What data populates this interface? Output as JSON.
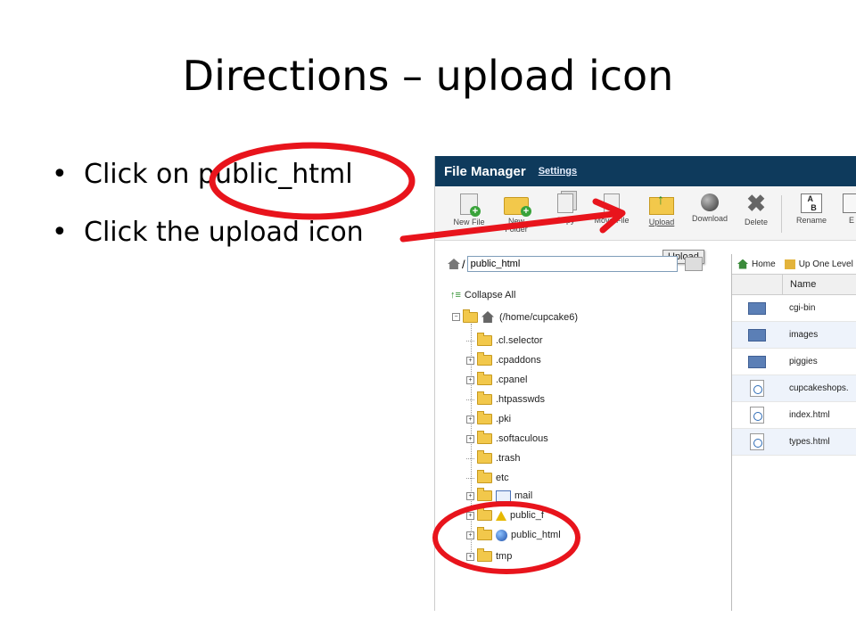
{
  "slide": {
    "title": "Directions – upload icon",
    "bullets": [
      "Click on public_html",
      "Click the upload icon"
    ]
  },
  "file_manager": {
    "title": "File Manager",
    "settings_link": "Settings",
    "toolbar": [
      {
        "label": "New File",
        "icon": "new-file-icon"
      },
      {
        "label": "New Folder",
        "icon": "new-folder-icon"
      },
      {
        "label": "Copy",
        "icon": "copy-icon"
      },
      {
        "label": "Move File",
        "icon": "move-icon"
      },
      {
        "label": "Upload",
        "icon": "upload-icon"
      },
      {
        "label": "Download",
        "icon": "download-icon"
      },
      {
        "label": "Delete",
        "icon": "delete-icon"
      },
      {
        "label": "Rename",
        "icon": "rename-icon"
      },
      {
        "label": "E",
        "icon": "edit-icon"
      }
    ],
    "tooltip": "Upload",
    "path_value": "public_html",
    "collapse_all": "Collapse All",
    "tree_root": "(/home/cupcake6)",
    "tree_items": [
      ".cl.selector",
      ".cpaddons",
      ".cpanel",
      ".htpasswds",
      ".pki",
      ".softaculous",
      ".trash",
      "etc",
      "mail",
      "public_f",
      "public_html",
      "tmp"
    ],
    "nav": {
      "home": "Home",
      "up_one_level": "Up One Level"
    },
    "columns": {
      "name": "Name"
    },
    "files": [
      "cgi-bin",
      "images",
      "piggies",
      "cupcakeshops.",
      "index.html",
      "types.html"
    ]
  },
  "colors": {
    "annotation": "#e8141c",
    "header_bg": "#0e3a5c"
  }
}
